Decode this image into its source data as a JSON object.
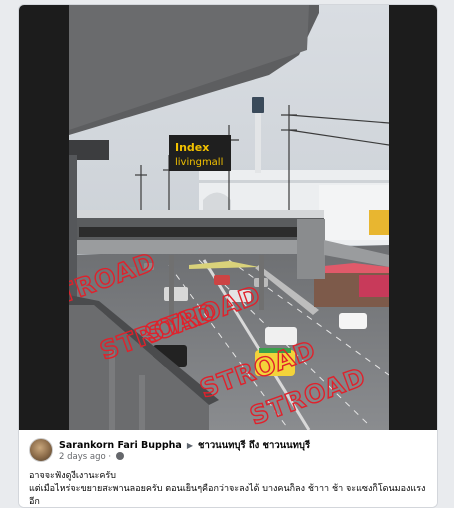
{
  "post": {
    "author": "Sarankorn Fari Buppha",
    "group_separator": "▶",
    "group": "ชาวนนทบุรี ถึง ชาวนนทบุรี",
    "timestamp": "2 days ago",
    "dot": "·",
    "privacy_icon": "globe-icon",
    "text_lines": [
      "อาจจะฟังดูงี่เงานะครับ",
      "แต่เมื่อไหร่จะขยายสะพานลอยครับ ตอนเย็นๆคือกว่าจะลงได้ บางคนก็ลง ช้าาา ช้า จะแซงก็โดนมองแรง",
      "อีก"
    ]
  },
  "photo": {
    "sign_line1": "Index",
    "sign_line2": "livingmall",
    "overlay_word": "STROAD",
    "overlay_count": 5
  },
  "colors": {
    "overlay": "#e0212b",
    "sign_bg": "#1f1f1f",
    "sign_text": "#f2c100"
  }
}
